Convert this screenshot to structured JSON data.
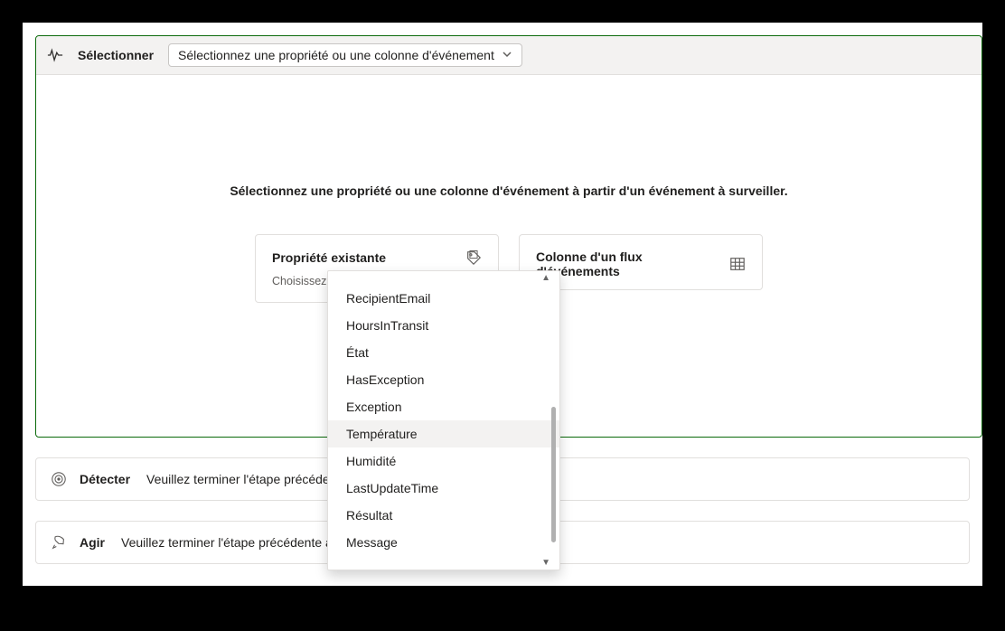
{
  "select_panel": {
    "title": "Sélectionner",
    "selector_placeholder": "Sélectionnez une propriété ou une colonne d'événement",
    "instruction": "Sélectionnez une propriété ou une colonne d'événement à partir d'un événement à surveiller."
  },
  "property_card": {
    "title": "Propriété existante",
    "subtitle": "Choisissez une propriété existante."
  },
  "stream_card": {
    "title": "Colonne d'un flux d'événements"
  },
  "dropdown": {
    "items": [
      {
        "label": "RecipientEmail",
        "selected": false
      },
      {
        "label": "HoursInTransit",
        "selected": false
      },
      {
        "label": "État",
        "selected": false
      },
      {
        "label": "HasException",
        "selected": false
      },
      {
        "label": "Exception",
        "selected": false
      },
      {
        "label": "Température",
        "selected": true
      },
      {
        "label": "Humidité",
        "selected": false
      },
      {
        "label": "LastUpdateTime",
        "selected": false
      },
      {
        "label": "Résultat",
        "selected": false
      },
      {
        "label": "Message",
        "selected": false
      }
    ]
  },
  "steps": {
    "detect": {
      "title": "Détecter",
      "desc": "Veuillez terminer l'étape précédente avant de travailler sur cette étape."
    },
    "act": {
      "title": "Agir",
      "desc": "Veuillez terminer l'étape précédente avant de travailler sur cette étape."
    }
  }
}
